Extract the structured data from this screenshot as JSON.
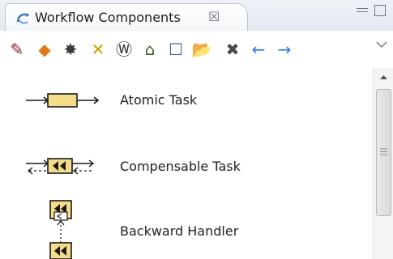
{
  "view": {
    "title": "Workflow Components",
    "close_glyph": "☒"
  },
  "toolbar": {
    "buttons": [
      {
        "name": "tool-1-icon",
        "color": "#7a1a1a",
        "glyph": "✎"
      },
      {
        "name": "tool-2-icon",
        "color": "#e07a1a",
        "glyph": "◆"
      },
      {
        "name": "tool-3-icon",
        "color": "#3a3a3a",
        "glyph": "✸"
      },
      {
        "name": "tool-4-icon",
        "color": "#c8a000",
        "glyph": "✕"
      },
      {
        "name": "wordpress-icon",
        "color": "#2a2a2a",
        "glyph": "Ⓦ"
      },
      {
        "name": "home-icon",
        "color": "#3c5a1a",
        "glyph": "⌂"
      },
      {
        "name": "window-icon",
        "color": "#2f5fa8",
        "glyph": "☐"
      },
      {
        "name": "open-folder-icon",
        "color": "#c89a2a",
        "glyph": "📂"
      },
      {
        "name": "delete-icon",
        "color": "#4a4a4a",
        "glyph": "✖"
      },
      {
        "name": "back-arrow-icon",
        "color": "#2a7ae2",
        "glyph": "←"
      },
      {
        "name": "forward-arrow-icon",
        "color": "#2a7ae2",
        "glyph": "→"
      }
    ]
  },
  "components": [
    {
      "label": "Atomic Task"
    },
    {
      "label": "Compensable Task"
    },
    {
      "label": "Backward Handler"
    }
  ],
  "colors": {
    "task_fill": "#f3dc8a",
    "task_stroke": "#1a1a1a"
  }
}
